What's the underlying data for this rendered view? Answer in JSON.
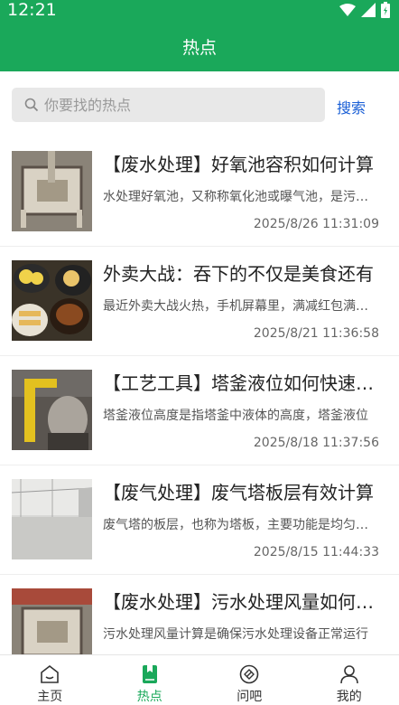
{
  "status": {
    "time": "12:21"
  },
  "header": {
    "title": "热点"
  },
  "search": {
    "placeholder": "你要找的热点",
    "button_label": "搜索"
  },
  "articles": [
    {
      "title": "【废水处理】好氧池容积如何计算",
      "desc": "水处理好氧池，又称称氧化池或曝气池，是污水处理的核心",
      "date": "2025/8/26 11:31:09"
    },
    {
      "title": "外卖大战：吞下的不仅是美食还有",
      "desc": "最近外卖大战火热，手机屏幕里，满减红包满天飞",
      "date": "2025/8/21 11:36:58"
    },
    {
      "title": "【工艺工具】塔釜液位如何快速计算",
      "desc": "塔釜液位高度是指塔釜中液体的高度，塔釜液位",
      "date": "2025/8/18 11:37:56"
    },
    {
      "title": "【废气处理】废气塔板层有效计算",
      "desc": "废气塔的板层，也称为塔板，主要功能是均匀分布",
      "date": "2025/8/15 11:44:33"
    },
    {
      "title": "【废水处理】污水处理风量如何计算",
      "desc": "污水处理风量计算是确保污水处理设备正常运行",
      "date": ""
    }
  ],
  "tabs": [
    {
      "label": "主页"
    },
    {
      "label": "热点"
    },
    {
      "label": "问吧"
    },
    {
      "label": "我的"
    }
  ],
  "colors": {
    "brand": "#1aa85a",
    "link": "#1a5fd6"
  }
}
